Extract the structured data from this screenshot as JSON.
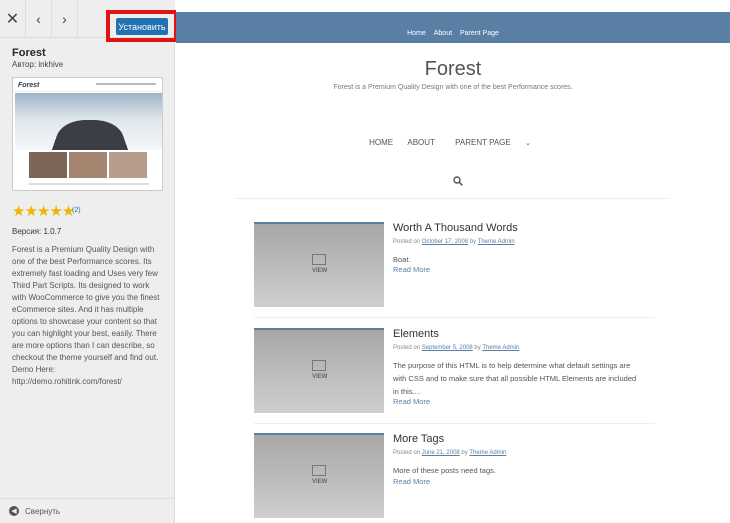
{
  "sidebar": {
    "theme_name": "Forest",
    "author": "Автор: inkhive",
    "install_label": "Установить",
    "rating_count": "(2)",
    "rating_value": 5,
    "stars": "★★★★★",
    "version": "Версия: 1.0.7",
    "description": "Forest is a Premium Quality Design with one of the best Performance scores. Its extremely fast loading and Uses very few Third Part Scripts. Its designed to work with WooCommerce to give you the finest eCommerce sites. And it has multiple options to showcase your content so that you can highlight your best, easily. There are more options than I can describe, so checkout the theme yourself and find out. Demo Here: http://demo.rohitink.com/forest/",
    "collapse_label": "Свернуть",
    "screenshot_logo": "Forest"
  },
  "preview": {
    "top_links": [
      "Home",
      "About",
      "Parent Page"
    ],
    "site_title": "Forest",
    "tagline": "Forest is a Premium Quality Design with one of the best Performance scores.",
    "nav": [
      "HOME",
      "ABOUT",
      "PARENT PAGE"
    ],
    "caret": "⌄",
    "thumb_label": "VIEW",
    "posts": [
      {
        "title": "Worth A Thousand Words",
        "posted_on": "Posted on",
        "date": "October 17, 2008",
        "by": "by",
        "author": "Theme Admin",
        "excerpt": "Boat.",
        "read_more": "Read More"
      },
      {
        "title": "Elements",
        "posted_on": "Posted on",
        "date": "September 5, 2008",
        "by": "by",
        "author": "Theme Admin",
        "excerpt": "The purpose of this HTML is to help determine what default settings are with CSS and to make sure that all possible HTML Elements are included in this....",
        "read_more": "Read More"
      },
      {
        "title": "More Tags",
        "posted_on": "Posted on",
        "date": "June 21, 2008",
        "by": "by",
        "author": "Theme Admin",
        "excerpt": "More of these posts need tags.",
        "read_more": "Read More"
      }
    ]
  },
  "colors": {
    "install_button": "#2271b1",
    "highlight_box": "#e21313",
    "header_bar": "#5a7fa5",
    "star": "#f0b400"
  },
  "icons": {
    "close": "close-icon",
    "prev": "chevron-left-icon",
    "next": "chevron-right-icon",
    "search": "search-icon",
    "collapse": "collapse-arrow-icon",
    "image": "image-icon"
  }
}
